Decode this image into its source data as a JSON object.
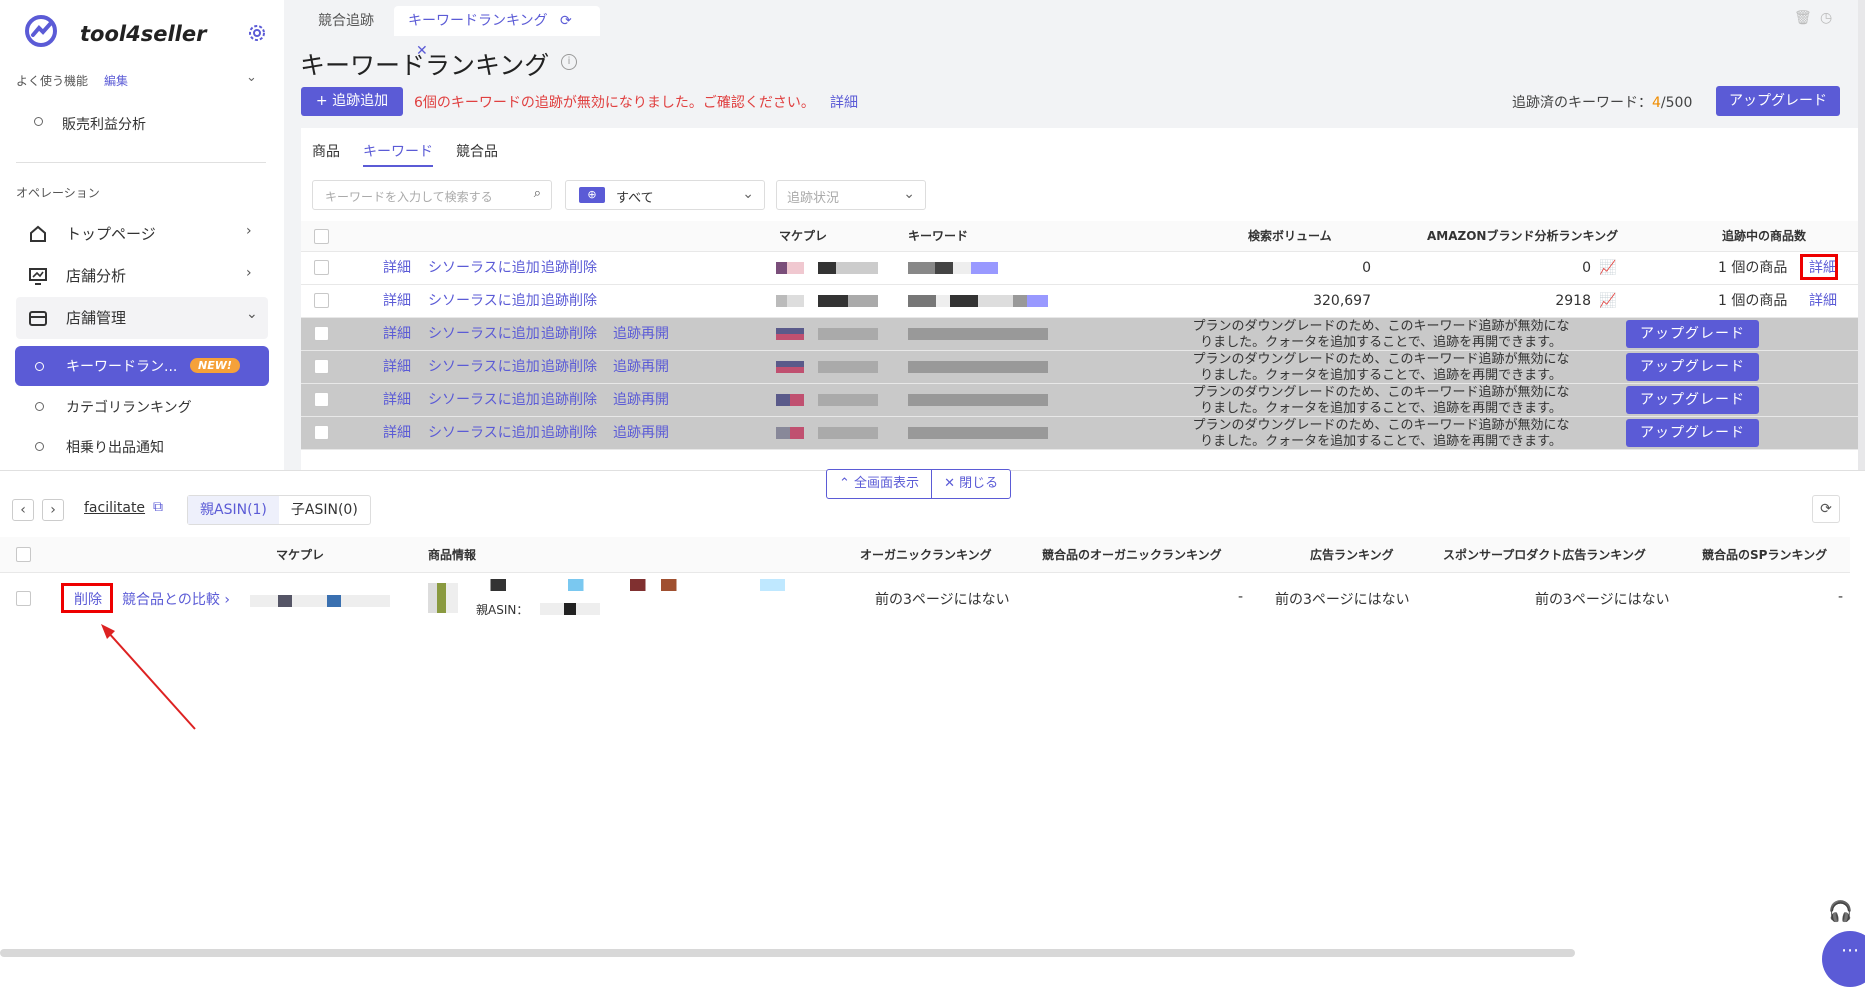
{
  "app": {
    "name": "tool4seller"
  },
  "sidebar": {
    "favorites_label": "よく使う機能",
    "edit_label": "編集",
    "fav_items": [
      {
        "label": "販売利益分析"
      }
    ],
    "operations_label": "オペレーション",
    "nav": [
      {
        "label": "トップページ"
      },
      {
        "label": "店舗分析"
      },
      {
        "label": "店舗管理"
      }
    ],
    "sub": [
      {
        "label": "キーワードラン...",
        "badge": "NEW!"
      },
      {
        "label": "カテゴリランキング"
      },
      {
        "label": "相乗り出品通知"
      }
    ]
  },
  "tabs": [
    {
      "label": "競合追跡"
    },
    {
      "label": "キーワードランキング"
    }
  ],
  "page": {
    "title": "キーワードランキング",
    "add_button": "追跡追加",
    "warning": "6個のキーワードの追跡が無効になりました。ご確認ください。",
    "warning_link": "詳細",
    "tracked_label": "追跡済のキーワード：",
    "tracked_count": "4",
    "tracked_total": "/500",
    "upgrade_button": "アップグレード"
  },
  "subtabs": [
    {
      "label": "商品"
    },
    {
      "label": "キーワード"
    },
    {
      "label": "競合品"
    }
  ],
  "filters": {
    "search_placeholder": "キーワードを入力して検索する",
    "market_value": "すべて",
    "status_placeholder": "追跡状況"
  },
  "table": {
    "headers": {
      "market": "マケプレ",
      "keyword": "キーワード",
      "volume": "検索ボリューム",
      "rank": "AMAZONブランド分析ランキング",
      "products": "追跡中の商品数"
    },
    "actions": {
      "detail": "詳細",
      "add_thesaurus": "シソーラスに追加",
      "delete": "追跡削除",
      "resume": "追跡再開"
    },
    "rows": [
      {
        "volume": "0",
        "rank": "0",
        "products": "1 個の商品",
        "detail": "詳細"
      },
      {
        "volume": "320,697",
        "rank": "2918",
        "products": "1 個の商品",
        "detail": "詳細"
      }
    ],
    "disabled_message_line1": "プランのダウングレードのため、このキーワード追跡が無効にな",
    "disabled_message_line2": "りました。クォータを追加することで、追跡を再開できます。",
    "upgrade": "アップグレード"
  },
  "panel": {
    "fullscreen": "全画面表示",
    "close": "閉じる",
    "keyword": "facilitate",
    "parent_tab": "親ASIN(1)",
    "child_tab": "子ASIN(0)",
    "headers": {
      "market": "マケプレ",
      "info": "商品情報",
      "organic": "オーガニックランキング",
      "comp_organic": "競合品のオーガニックランキング",
      "ad": "広告ランキング",
      "sp": "スポンサープロダクト広告ランキング",
      "comp_sp": "競合品のSPランキング"
    },
    "row": {
      "delete": "削除",
      "compare": "競合品との比較",
      "parent_asin_label": "親ASIN：",
      "organic": "前の3ページにはない",
      "comp_organic": "-",
      "ad": "前の3ページにはない",
      "sp": "前の3ページにはない",
      "comp_sp": "-"
    }
  }
}
